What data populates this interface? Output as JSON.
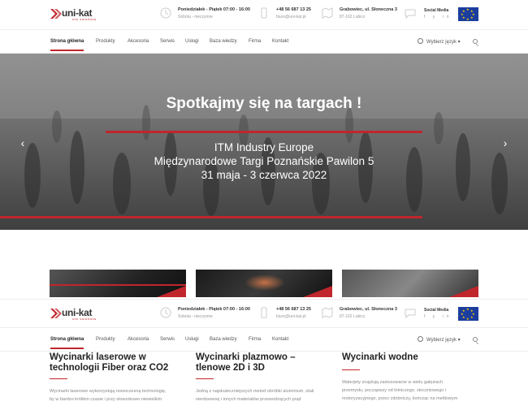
{
  "brand": {
    "name": "uni-kat",
    "tagline": "cnc solutions"
  },
  "header": {
    "hours": {
      "line1": "Poniedziałek - Piątek 07:00 - 16:00",
      "line2": "Sobota - nieczynne"
    },
    "contact": {
      "line1": "+48 56 687 13 25",
      "line2": "biuro@uni-kat.pl"
    },
    "address": {
      "line1": "Grabowiec, ul. Słoneczna 3",
      "line2": "87-162 Lubicz"
    },
    "social": {
      "title": "Social Media",
      "icons": "f  y  in"
    }
  },
  "nav": {
    "items": [
      "Strona główna",
      "Produkty",
      "Akcesoria",
      "Serwis",
      "Usługi",
      "Baza wiedzy",
      "Firma",
      "Kontakt"
    ],
    "language": "Wybierz język"
  },
  "hero": {
    "title": "Spotkajmy się na targach !",
    "line1": "ITM Industry Europe",
    "line2": "Międzynarodowe Targi Poznańskie Pawilon 5",
    "line3": "31 maja - 3 czerwca 2022",
    "prev": "‹",
    "next": "›"
  },
  "columns": [
    {
      "title1": "Wycinarki laserowe w",
      "title2": "technologii Fiber oraz CO2",
      "text1": "Wycinarki laserowe wykorzystują nowoczesną technologię,",
      "text2": "by w bardzo krótkim czasie i przy stosunkowo niewielkim"
    },
    {
      "title1": "Wycinarki plazmowo –",
      "title2": "tlenowe 2D i 3D",
      "text1": "Jedną z najskuteczniejszych metod obróbki aluminium, stali",
      "text2": "nierdzewnej i innych materiałów przewodzących prąd"
    },
    {
      "title1": "Wycinarki wodne",
      "title2": "",
      "text1": "Waterjety znajdują zastosowanie w wielu gałęziach",
      "text2": "przemysłu, począwszy od lotniczego, stoczniowego i",
      "text3": "motoryzacyjnego, przez zdobniczy, kończąc na meblowym"
    }
  ],
  "colors": {
    "accent": "#c0262c",
    "eu_blue": "#1b3d9e"
  }
}
